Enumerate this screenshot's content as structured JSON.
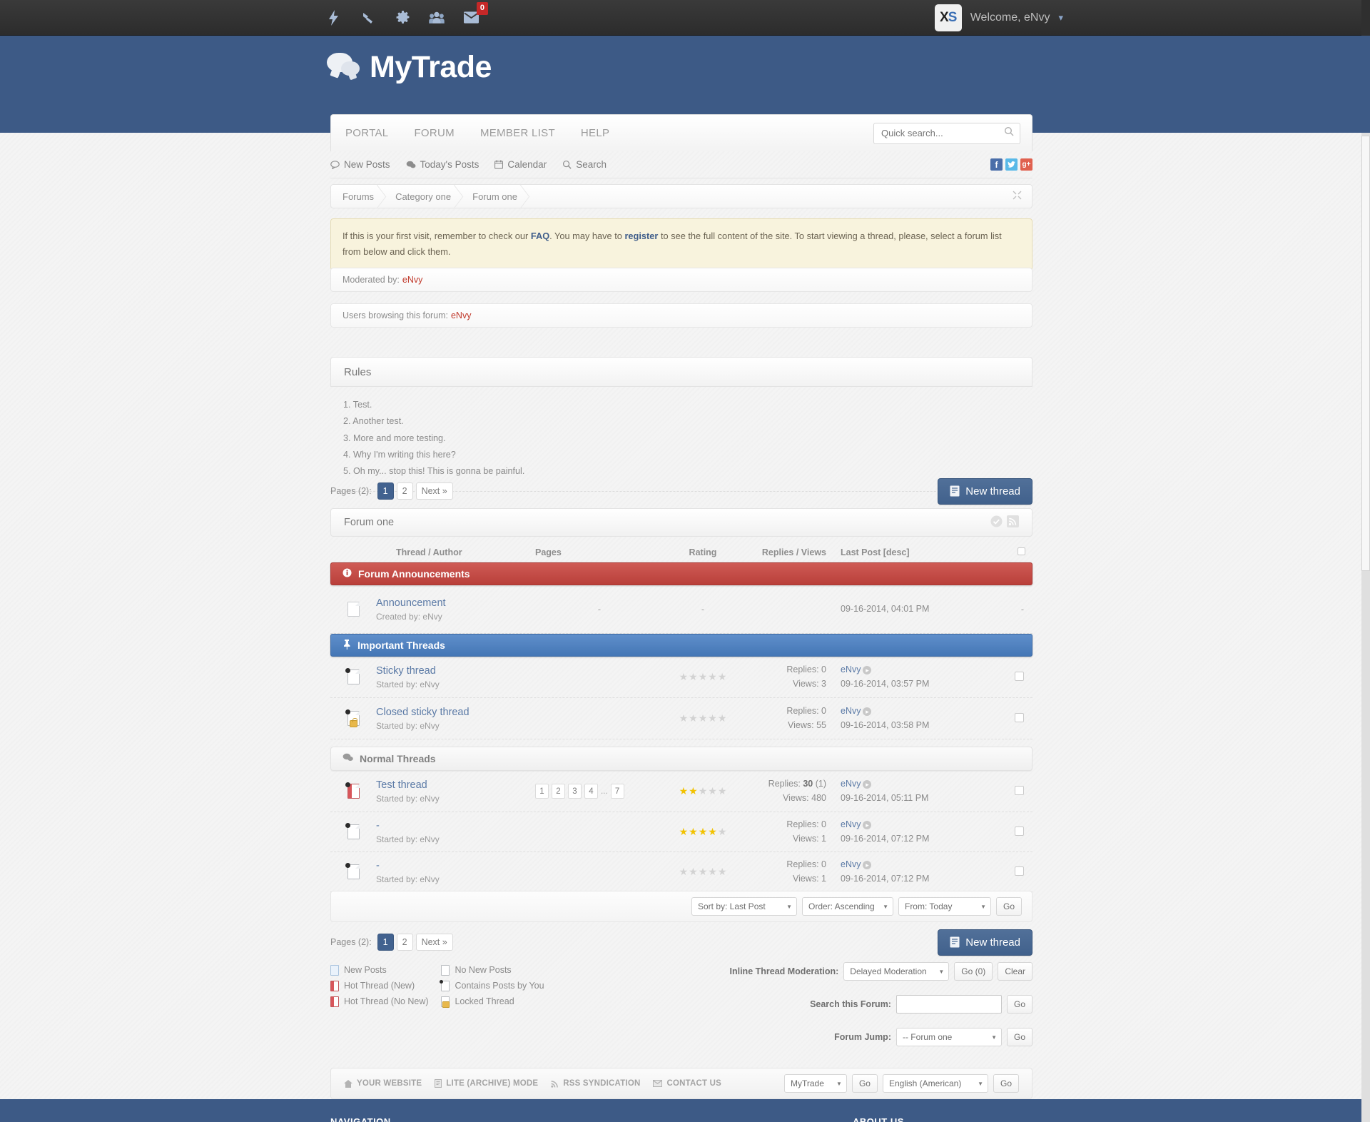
{
  "topbar": {
    "icons": [
      {
        "name": "lightning-icon",
        "label": "Activity"
      },
      {
        "name": "flag-icon",
        "label": "Reports"
      },
      {
        "name": "gear-icon",
        "label": "Settings"
      },
      {
        "name": "users-icon",
        "label": "Buddy List"
      },
      {
        "name": "envelope-icon",
        "label": "Messages"
      }
    ],
    "message_count": "0",
    "logo_text_x": "X",
    "logo_text_s": "S",
    "welcome": "Welcome, eNvy",
    "caret": "▾"
  },
  "header": {
    "site_title": "MyTrade"
  },
  "nav": {
    "items": [
      "PORTAL",
      "FORUM",
      "MEMBER LIST",
      "HELP"
    ],
    "search_placeholder": "Quick search..."
  },
  "sublinks": {
    "items": [
      {
        "label": "New Posts",
        "icon": "comment-icon"
      },
      {
        "label": "Today's Posts",
        "icon": "comments-icon"
      },
      {
        "label": "Calendar",
        "icon": "calendar-icon"
      },
      {
        "label": "Search",
        "icon": "search-icon"
      }
    ],
    "social": [
      {
        "name": "facebook-icon",
        "glyph": "f",
        "color": "#4a6ea9"
      },
      {
        "name": "twitter-icon",
        "glyph": "ᵗ",
        "color": "#59b9e8"
      },
      {
        "name": "googleplus-icon",
        "glyph": "g+",
        "color": "#e0614f"
      }
    ]
  },
  "breadcrumb": {
    "items": [
      "Forums",
      "Category one",
      "Forum one"
    ],
    "collapse_icon": "collapse-icon"
  },
  "notice": {
    "part1": "If this is your first visit, remember to check our ",
    "link1": "FAQ",
    "part2": ". You may have to ",
    "link2": "register",
    "part3": " to see the full content of the site. To start viewing a thread, please, select a forum list from below and click them."
  },
  "moderated": {
    "label": "Moderated by:",
    "user": "eNvy"
  },
  "browsing": {
    "label": "Users browsing this forum:",
    "user": "eNvy"
  },
  "rules": {
    "title": "Rules",
    "items": [
      "1. Test.",
      "2. Another test.",
      "3. More and more testing.",
      "4. Why I'm writing this here?",
      "5. Oh my... stop this! This is gonna be painful."
    ]
  },
  "pagination": {
    "label": "Pages (2):",
    "pages": [
      "1",
      "2"
    ],
    "next": "Next »",
    "active": "1"
  },
  "new_thread_button": "New thread",
  "forum": {
    "title": "Forum one",
    "columns": {
      "thread": "Thread / Author",
      "pages": "Pages",
      "rating": "Rating",
      "replies": "Replies / Views",
      "lastpost": "Last Post [desc]"
    }
  },
  "sections": [
    {
      "name": "Forum Announcements",
      "icon": "info-icon",
      "style": "red"
    },
    {
      "name": "Important Threads",
      "icon": "pin-icon",
      "style": "blue"
    },
    {
      "name": "Normal Threads",
      "icon": "comments-icon",
      "style": "grey"
    }
  ],
  "announcement": {
    "title": "Announcement",
    "author_prefix": "Created by:",
    "author": "eNvy",
    "pages": "-",
    "rating": "-",
    "date": "09-16-2014, 04:01 PM",
    "trailing": "-"
  },
  "important_threads": [
    {
      "icon": "doc-dot-icon",
      "title": "Sticky thread",
      "author_prefix": "Started by:",
      "author": "eNvy",
      "stars": 0,
      "replies_label": "Replies:",
      "replies": "0",
      "views_label": "Views:",
      "views": "3",
      "last_user": "eNvy",
      "last_date": "09-16-2014, 03:57 PM"
    },
    {
      "icon": "doc-lock-icon",
      "title": "Closed sticky thread",
      "author_prefix": "Started by:",
      "author": "eNvy",
      "stars": 0,
      "replies_label": "Replies:",
      "replies": "0",
      "views_label": "Views:",
      "views": "55",
      "last_user": "eNvy",
      "last_date": "09-16-2014, 03:58 PM"
    }
  ],
  "normal_threads": [
    {
      "icon": "doc-hot-icon",
      "title": "Test thread",
      "author_prefix": "Started by:",
      "author": "eNvy",
      "pages": [
        "1",
        "2",
        "3",
        "4",
        "...",
        "7"
      ],
      "stars": 2,
      "replies_label": "Replies:",
      "replies": "30",
      "replies_extra": "(1)",
      "views_label": "Views:",
      "views": "480",
      "last_user": "eNvy",
      "last_date": "09-16-2014, 05:11 PM"
    },
    {
      "icon": "doc-dot-icon",
      "title": "-",
      "author_prefix": "Started by:",
      "author": "eNvy",
      "pages": [],
      "stars": 4,
      "replies_label": "Replies:",
      "replies": "0",
      "replies_extra": "",
      "views_label": "Views:",
      "views": "1",
      "last_user": "eNvy",
      "last_date": "09-16-2014, 07:12 PM"
    },
    {
      "icon": "doc-dot-icon",
      "title": "-",
      "author_prefix": "Started by:",
      "author": "eNvy",
      "pages": [],
      "stars": 0,
      "replies_label": "Replies:",
      "replies": "0",
      "replies_extra": "",
      "views_label": "Views:",
      "views": "1",
      "last_user": "eNvy",
      "last_date": "09-16-2014, 07:12 PM"
    }
  ],
  "sortbar": {
    "sort_by": "Sort by: Last Post",
    "order": "Order: Ascending",
    "from": "From: Today",
    "go": "Go"
  },
  "legend": [
    {
      "icon": "new-posts-icon",
      "label": "New Posts"
    },
    {
      "icon": "no-new-posts-icon",
      "label": "No New Posts"
    },
    {
      "icon": "hot-thread-new-icon",
      "label": "Hot Thread (New)"
    },
    {
      "icon": "contains-posts-icon",
      "label": "Contains Posts by You"
    },
    {
      "icon": "hot-thread-nonew-icon",
      "label": "Hot Thread (No New)"
    },
    {
      "icon": "locked-thread-icon",
      "label": "Locked Thread"
    }
  ],
  "tools": {
    "inline_mod_label": "Inline Thread Moderation:",
    "inline_mod_value": "Delayed Moderation",
    "inline_mod_go": "Go (0)",
    "inline_mod_clear": "Clear",
    "search_label": "Search this Forum:",
    "search_value": "",
    "search_go": "Go",
    "jump_label": "Forum Jump:",
    "jump_value": "-- Forum one",
    "jump_go": "Go"
  },
  "footer": {
    "links": [
      {
        "icon": "home-icon",
        "label": "YOUR WEBSITE"
      },
      {
        "icon": "archive-icon",
        "label": "LITE (ARCHIVE) MODE"
      },
      {
        "icon": "rss-icon",
        "label": "RSS SYNDICATION"
      },
      {
        "icon": "mail-icon",
        "label": "CONTACT US"
      }
    ],
    "theme_select": "MyTrade",
    "theme_go": "Go",
    "lang_select": "English (American)",
    "lang_go": "Go",
    "nav_heading": "NAVIGATION",
    "about_heading": "ABOUT US"
  }
}
